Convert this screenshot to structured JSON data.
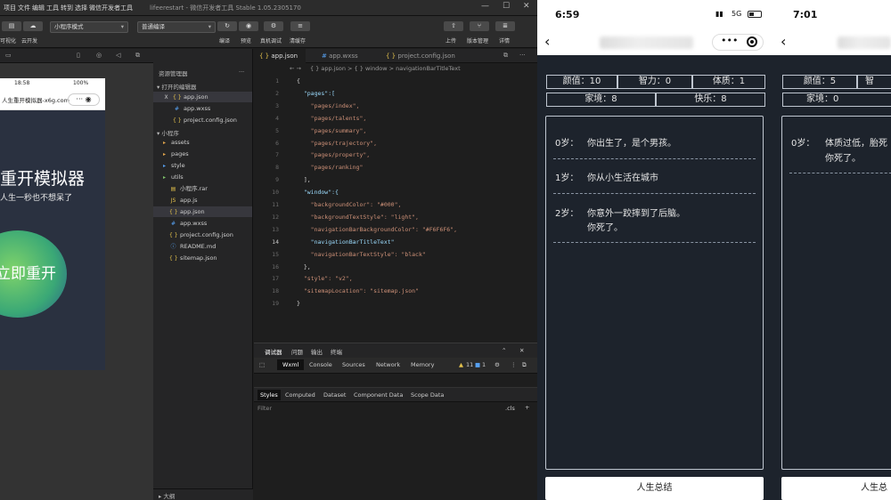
{
  "ide": {
    "menu": [
      "项目",
      "文件",
      "编辑",
      "工具",
      "转到",
      "选择",
      "视图",
      "界面",
      "设置",
      "帮助",
      "微信开发者工具"
    ],
    "window_title": "lifeerestart - 微信开发者工具 Stable 1.05.2305170",
    "window_controls": [
      "—",
      "☐",
      "✕"
    ],
    "toolbar": {
      "left_labels": [
        "可视化",
        "云开发"
      ],
      "mode_dropdown": "小程序模式",
      "compile_dropdown": "普通编译",
      "center_labels": [
        "编译",
        "预览",
        "真机调试",
        "清缓存"
      ],
      "right_labels": [
        "上传",
        "版本管理",
        "详情"
      ]
    },
    "simulator": {
      "time": "18:58",
      "battery": "100%",
      "page_title": "人生重开模拟器-x6g.com",
      "hero_title": "重开模拟器",
      "hero_sub": "人生一秒也不想呆了",
      "button": "立即重开"
    },
    "explorer": {
      "title": "资源管理器",
      "open_editors": "打开的编辑器",
      "open_files": [
        {
          "name": "app.json",
          "icon": "{ }",
          "prefix": "X"
        },
        {
          "name": "app.wxss",
          "icon": "#"
        },
        {
          "name": "project.config.json",
          "icon": "{ }"
        }
      ],
      "project": "小程序",
      "tree": [
        {
          "name": "assets",
          "icon": "▸",
          "kind": "folder"
        },
        {
          "name": "pages",
          "icon": "▸",
          "kind": "folder"
        },
        {
          "name": "style",
          "icon": "▸",
          "kind": "folder"
        },
        {
          "name": "utils",
          "icon": "▸",
          "kind": "folder"
        },
        {
          "name": "小程序.rar",
          "icon": "▤",
          "kind": "file"
        },
        {
          "name": "app.js",
          "icon": "JS",
          "kind": "file"
        },
        {
          "name": "app.json",
          "icon": "{ }",
          "kind": "file"
        },
        {
          "name": "app.wxss",
          "icon": "#",
          "kind": "file"
        },
        {
          "name": "project.config.json",
          "icon": "{ }",
          "kind": "file"
        },
        {
          "name": "README.md",
          "icon": "ⓘ",
          "kind": "file"
        },
        {
          "name": "sitemap.json",
          "icon": "{ }",
          "kind": "file"
        }
      ],
      "outline": "大纲"
    },
    "editor": {
      "tabs": [
        "app.json",
        "app.wxss",
        "project.config.json"
      ],
      "breadcrumb": "{ } app.json > { } window > navigationBarTitleText",
      "lines": [
        {
          "n": "1",
          "t": "{"
        },
        {
          "n": "2",
          "t": "  \"pages\":["
        },
        {
          "n": "3",
          "t": "    \"pages/index\","
        },
        {
          "n": "4",
          "t": "    \"pages/talents\","
        },
        {
          "n": "5",
          "t": "    \"pages/summary\","
        },
        {
          "n": "6",
          "t": "    \"pages/trajectory\","
        },
        {
          "n": "7",
          "t": "    \"pages/property\","
        },
        {
          "n": "8",
          "t": "    \"pages/ranking\""
        },
        {
          "n": "9",
          "t": "  ],"
        },
        {
          "n": "10",
          "t": "  \"window\":{"
        },
        {
          "n": "11",
          "t": "    \"backgroundColor\": \"#000\","
        },
        {
          "n": "12",
          "t": "    \"backgroundTextStyle\": \"light\","
        },
        {
          "n": "13",
          "t": "    \"navigationBarBackgroundColor\": \"#F6F6F6\","
        },
        {
          "n": "14",
          "t": "    \"navigationBarTitleText\""
        },
        {
          "n": "15",
          "t": "    \"navigationBarTextStyle\": \"black\""
        },
        {
          "n": "16",
          "t": "  },"
        },
        {
          "n": "17",
          "t": "  \"style\": \"v2\","
        },
        {
          "n": "18",
          "t": "  \"sitemapLocation\": \"sitemap.json\""
        },
        {
          "n": "19",
          "t": "}"
        }
      ]
    },
    "debugger": {
      "head_tabs": [
        "调试器",
        "问题",
        "输出",
        "终端"
      ],
      "tools": [
        "Wxml",
        "Console",
        "Sources",
        "Network",
        "Memory"
      ],
      "warnings": "11",
      "errors": "1",
      "sub_tabs": [
        "Styles",
        "Computed",
        "Dataset",
        "Component Data",
        "Scope Data"
      ],
      "filter": "Filter",
      "cls": ".cls"
    }
  },
  "phone2": {
    "time": "6:59",
    "signal": "5G",
    "stats_row1": [
      "颜值：10",
      "智力：0",
      "体质：1"
    ],
    "stats_row2": [
      "家境：8",
      "快乐：8"
    ],
    "events": [
      {
        "age": "0岁：",
        "text": [
          "你出生了，是个男孩。"
        ]
      },
      {
        "age": "1岁：",
        "text": [
          "你从小生活在城市"
        ]
      },
      {
        "age": "2岁：",
        "text": [
          "你意外一跤摔到了后脑。",
          "你死了。"
        ]
      }
    ],
    "summary_button": "人生总结"
  },
  "phone3": {
    "time": "7:01",
    "stats_row1": [
      "颜值：5",
      "智"
    ],
    "stats_row2": [
      "家境：0"
    ],
    "events": [
      {
        "age": "0岁：",
        "text": [
          "体质过低，胎死",
          "你死了。"
        ]
      }
    ],
    "summary_button": "人生总"
  }
}
